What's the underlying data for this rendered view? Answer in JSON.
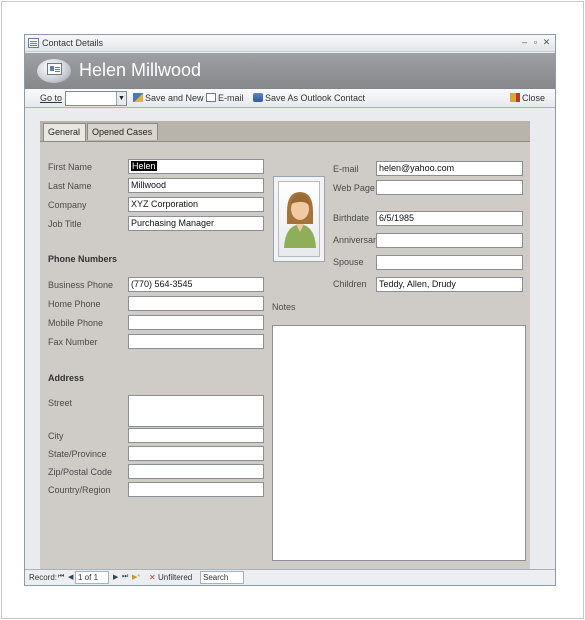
{
  "window": {
    "title": "Contact Details",
    "controls": [
      "‒",
      "▫",
      "✕"
    ]
  },
  "header": {
    "name": "Helen Millwood"
  },
  "toolbar": {
    "goto_label": "Go to",
    "goto_value": "",
    "save_new_label": "Save and New",
    "email_label": "E-mail",
    "save_outlook_label": "Save As Outlook Contact",
    "close_label": "Close"
  },
  "tabs": [
    {
      "label": "General",
      "active": true
    },
    {
      "label": "Opened Cases",
      "active": false
    }
  ],
  "general": {
    "first_name_label": "First Name",
    "first_name": "Helen",
    "last_name_label": "Last Name",
    "last_name": "Millwood",
    "company_label": "Company",
    "company": "XYZ Corporation",
    "job_title_label": "Job Title",
    "job_title": "Purchasing Manager",
    "phone_section": "Phone Numbers",
    "business_phone_label": "Business Phone",
    "business_phone": "(770) 564-3545",
    "home_phone_label": "Home Phone",
    "home_phone": "",
    "mobile_phone_label": "Mobile Phone",
    "mobile_phone": "",
    "fax_label": "Fax Number",
    "fax": "",
    "address_section": "Address",
    "street_label": "Street",
    "street": "",
    "city_label": "City",
    "city": "",
    "state_label": "State/Province",
    "state": "",
    "zip_label": "Zip/Postal Code",
    "zip": "",
    "country_label": "Country/Region",
    "country": "",
    "email_label": "E-mail",
    "email": "helen@yahoo.com",
    "web_label": "Web Page",
    "web": "",
    "birthdate_label": "Birthdate",
    "birthdate": "6/5/1985",
    "anniversary_label": "Anniversary",
    "anniversary": "",
    "spouse_label": "Spouse",
    "spouse": "",
    "children_label": "Children",
    "children": "Teddy, Allen, Drudy",
    "notes_label": "Notes",
    "notes": ""
  },
  "statusbar": {
    "record_label": "Record:",
    "record_position": "1 of 1",
    "filter_label": "Unfiltered",
    "search_label": "Search"
  },
  "colors": {
    "header_bg": "#8e9094",
    "panel_bg": "#cfccc7",
    "avatar_green": "#8fae5a",
    "avatar_hair": "#a5733a"
  }
}
